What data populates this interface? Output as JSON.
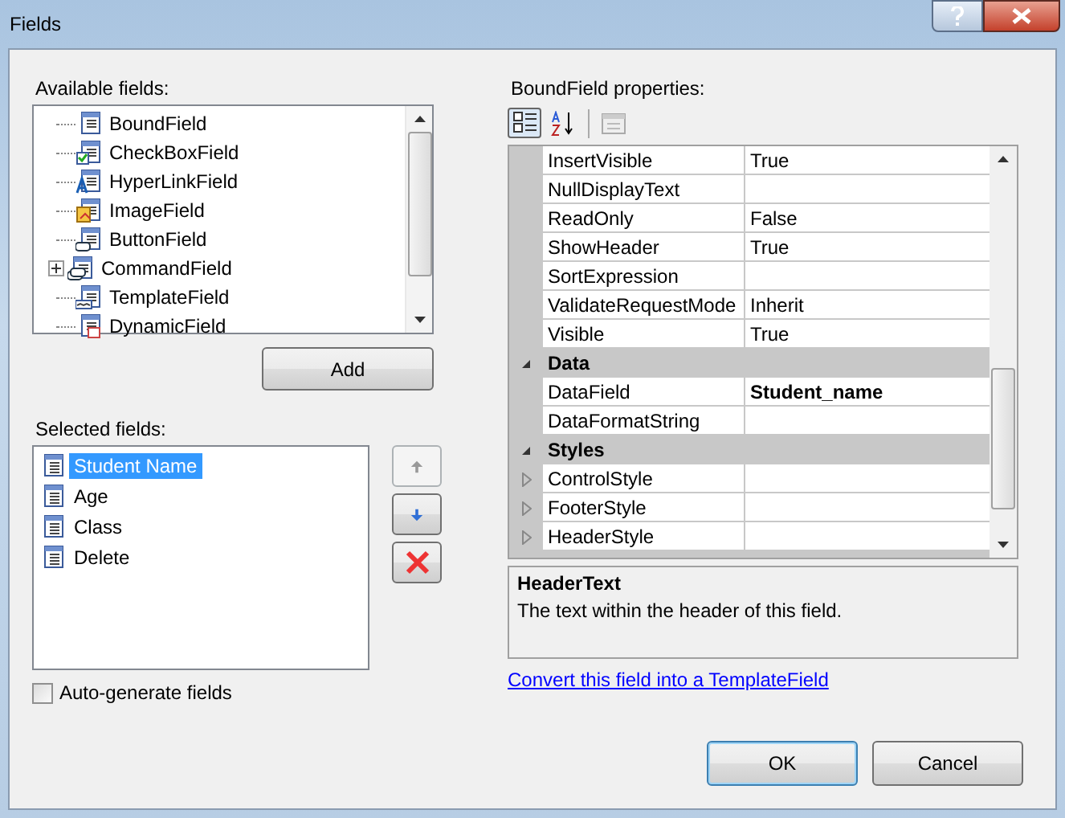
{
  "window": {
    "title": "Fields"
  },
  "available_fields": {
    "label": "Available fields:",
    "items": [
      {
        "label": "BoundField",
        "selected": false,
        "expandable": false
      },
      {
        "label": "CheckBoxField",
        "selected": false,
        "expandable": false
      },
      {
        "label": "HyperLinkField",
        "selected": false,
        "expandable": false
      },
      {
        "label": "ImageField",
        "selected": false,
        "expandable": false
      },
      {
        "label": "ButtonField",
        "selected": false,
        "expandable": false
      },
      {
        "label": "CommandField",
        "selected": false,
        "expandable": true
      },
      {
        "label": "TemplateField",
        "selected": false,
        "expandable": false
      },
      {
        "label": "DynamicField",
        "selected": false,
        "expandable": false
      }
    ]
  },
  "add_button": "Add",
  "selected_fields": {
    "label": "Selected fields:",
    "items": [
      {
        "label": "Student Name",
        "selected": true
      },
      {
        "label": "Age",
        "selected": false
      },
      {
        "label": "Class",
        "selected": false
      },
      {
        "label": "Delete",
        "selected": false
      }
    ]
  },
  "move_buttons": [
    {
      "kind": "up",
      "disabled": true
    },
    {
      "kind": "down",
      "disabled": false
    },
    {
      "kind": "delete",
      "disabled": false
    }
  ],
  "auto_generate": {
    "label": "Auto-generate fields",
    "checked": false
  },
  "properties": {
    "label": "BoundField properties:",
    "toolbar": [
      {
        "kind": "categorized",
        "selected": true
      },
      {
        "kind": "alphabetical",
        "selected": false
      }
    ],
    "rows": [
      {
        "kind": "property",
        "name": "InsertVisible",
        "value": "True",
        "modified": false
      },
      {
        "kind": "property",
        "name": "NullDisplayText",
        "value": ""
      },
      {
        "kind": "property",
        "name": "ReadOnly",
        "value": "False",
        "modified": false
      },
      {
        "kind": "property",
        "name": "ShowHeader",
        "value": "True",
        "modified": false
      },
      {
        "kind": "property",
        "name": "SortExpression",
        "value": ""
      },
      {
        "kind": "property",
        "name": "ValidateRequestMode",
        "value": "Inherit",
        "modified": false
      },
      {
        "kind": "property",
        "name": "Visible",
        "value": "True",
        "modified": false
      },
      {
        "kind": "category",
        "name": "Data",
        "expanded": true
      },
      {
        "kind": "property",
        "name": "DataField",
        "value": "Student_name",
        "modified": true
      },
      {
        "kind": "property",
        "name": "DataFormatString",
        "value": ""
      },
      {
        "kind": "category",
        "name": "Styles",
        "expanded": true
      },
      {
        "kind": "expandable",
        "name": "ControlStyle",
        "value": ""
      },
      {
        "kind": "expandable",
        "name": "FooterStyle",
        "value": ""
      },
      {
        "kind": "expandable",
        "name": "HeaderStyle",
        "value": ""
      }
    ],
    "description": {
      "title": "HeaderText",
      "text": "The text within the header of this field."
    }
  },
  "convert_link": "Convert this field into a TemplateField",
  "buttons": [
    {
      "label": "OK",
      "default": true
    },
    {
      "label": "Cancel",
      "default": false
    }
  ]
}
